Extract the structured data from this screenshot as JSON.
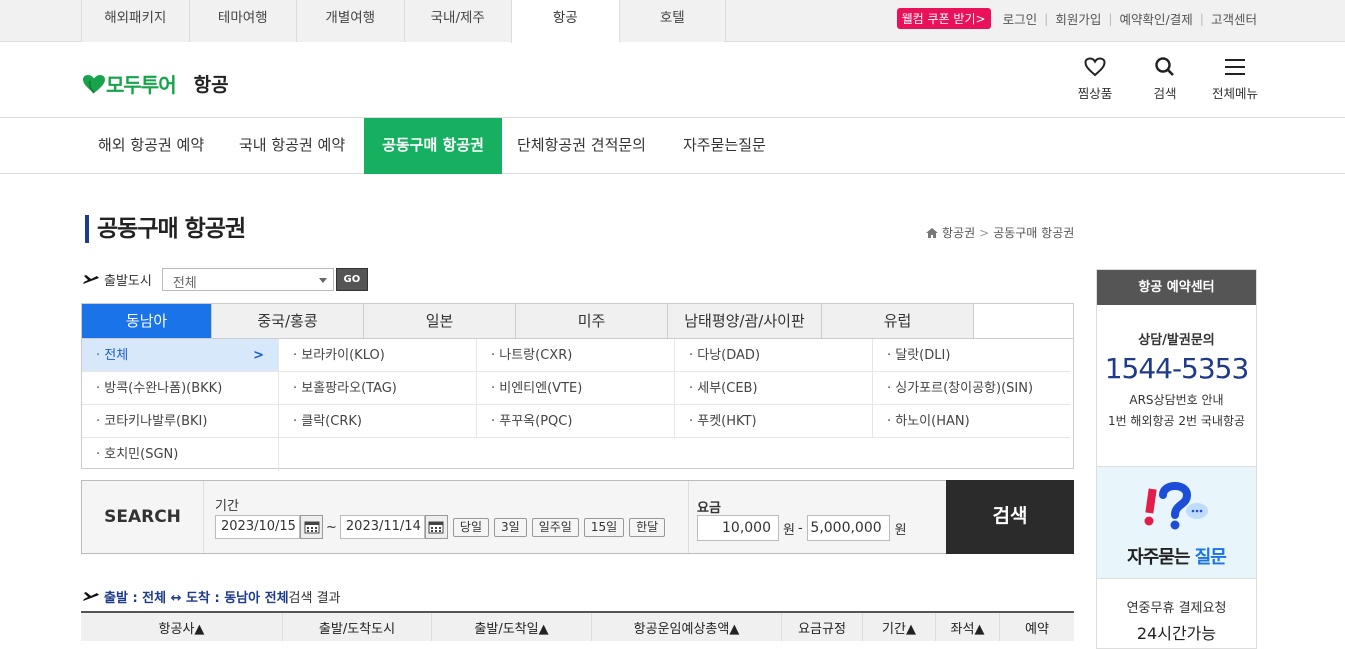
{
  "gnb": {
    "tabs": [
      "해외패키지",
      "테마여행",
      "개별여행",
      "국내/제주",
      "항공",
      "호텔"
    ],
    "active": "항공",
    "coupon": "웰컴 쿠폰 받기>",
    "links": [
      "로그인",
      "회원가입",
      "예약확인/결제",
      "고객센터"
    ]
  },
  "header": {
    "logo": "모두투어",
    "section": "항공",
    "icons": [
      {
        "icon": "heart-icon",
        "label": "찜상품"
      },
      {
        "icon": "search-icon",
        "label": "검색"
      },
      {
        "icon": "menu-icon",
        "label": "전체메뉴"
      }
    ]
  },
  "subnav": [
    "해외 항공권 예약",
    "국내 항공권 예약",
    "공동구매 항공권",
    "단체항공권 견적문의",
    "자주묻는질문"
  ],
  "page": {
    "title": "공동구매 항공권",
    "breadcrumb": [
      "항공권",
      "공동구매 항공권"
    ]
  },
  "filter": {
    "label": "출발도시",
    "select_value": "전체",
    "go": "GO"
  },
  "regions": {
    "tabs": [
      "동남아",
      "중국/홍콩",
      "일본",
      "미주",
      "남태평양/괌/사이판",
      "유럽"
    ],
    "active": "동남아",
    "cities": [
      "· 전체",
      "· 보라카이(KLO)",
      "· 나트랑(CXR)",
      "· 다낭(DAD)",
      "· 달랏(DLI)",
      "· 방콕(수완나폼)(BKK)",
      "· 보홀팡라오(TAG)",
      "· 비엔티엔(VTE)",
      "· 세부(CEB)",
      "· 싱가포르(창이공항)(SIN)",
      "· 코타키나발루(BKI)",
      "· 클락(CRK)",
      "· 푸꾸옥(PQC)",
      "· 푸켓(HKT)",
      "· 하노이(HAN)",
      "· 호치민(SGN)"
    ]
  },
  "search": {
    "label": "SEARCH",
    "period_label": "기간",
    "date_from": "2023/10/15",
    "date_to": "2023/11/14",
    "tilde": "~",
    "quick": [
      "당일",
      "3일",
      "일주일",
      "15일",
      "한달"
    ],
    "price_label": "요금",
    "price_min": "10,000",
    "price_max": "5,000,000",
    "won": "원",
    "dash": "-",
    "button": "검색"
  },
  "result": {
    "prefix": "출발 : 전체 ↔ 도착 : 동남아 전체",
    "suffix": " 검색 결과"
  },
  "table": {
    "headers": [
      "항공사▲",
      "출발/도착도시",
      "출발/도착일▲",
      "항공운임예상총액▲",
      "요금규정",
      "기간▲",
      "좌석▲",
      "예약"
    ]
  },
  "sidebar": {
    "title": "항공 예약센터",
    "consult": "상담/발권문의",
    "phone": "1544-5353",
    "ars": "ARS상담번호 안내",
    "ars_detail": "1번 해외항공 2번 국내항공",
    "faq_a": "자주묻는 ",
    "faq_b": "질문",
    "bottom1": "연중무휴 결제요청",
    "bottom2": "24시간가능"
  }
}
